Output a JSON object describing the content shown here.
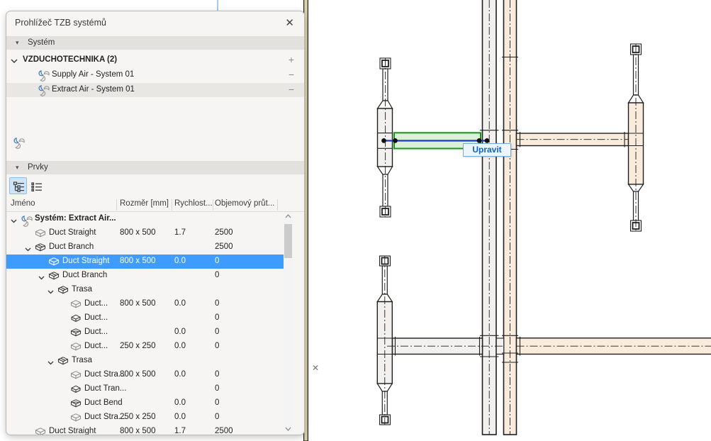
{
  "panel": {
    "title": "Prohlížeč TZB systémů",
    "close_glyph": "✕",
    "sections": {
      "system_label": "Systém",
      "elements_label": "Prvky"
    },
    "system_group": {
      "name": "VZDUCHOTECHNIKA (2)",
      "add_glyph": "+",
      "remove_glyph": "−",
      "items": [
        {
          "label": "Supply Air - System 01",
          "selected": false
        },
        {
          "label": "Extract Air - System 01",
          "selected": true
        }
      ]
    },
    "view_toggles": [
      {
        "icon": "tree-view-icon",
        "active": true
      },
      {
        "icon": "list-view-icon",
        "active": false
      }
    ],
    "table": {
      "columns": [
        "Jméno",
        "Rozměr [mm]",
        "Rychlost...",
        "Objemový průt..."
      ],
      "rows": [
        {
          "level": 0,
          "chevron": true,
          "icon": "fan-icon",
          "label": "Systém: Extract Air...",
          "bold": true,
          "size": "",
          "velocity": "",
          "flow": ""
        },
        {
          "level": 1,
          "chevron": false,
          "icon": "duct-straight-icon",
          "label": "Duct Straight",
          "bold": false,
          "size": "800 x 500",
          "velocity": "1.7",
          "flow": "2500"
        },
        {
          "level": 1,
          "chevron": true,
          "icon": "duct-branch-icon",
          "label": "Duct Branch",
          "bold": false,
          "size": "",
          "velocity": "",
          "flow": "2500"
        },
        {
          "level": 2,
          "chevron": false,
          "icon": "duct-straight-icon",
          "label": "Duct Straight",
          "bold": false,
          "size": "800 x 500",
          "velocity": "0.0",
          "flow": "0",
          "selected": true
        },
        {
          "level": 2,
          "chevron": true,
          "icon": "duct-branch-icon",
          "label": "Duct Branch",
          "bold": false,
          "size": "",
          "velocity": "",
          "flow": "0"
        },
        {
          "level": 3,
          "chevron": true,
          "icon": "duct-branch-icon",
          "label": "Trasa",
          "bold": false,
          "size": "",
          "velocity": "",
          "flow": ""
        },
        {
          "level": 4,
          "chevron": false,
          "icon": "duct-straight-icon",
          "label": "Duct...",
          "bold": false,
          "size": "800 x 500",
          "velocity": "0.0",
          "flow": "0"
        },
        {
          "level": 4,
          "chevron": false,
          "icon": "duct-transition-icon",
          "label": "Duct...",
          "bold": false,
          "size": "",
          "velocity": "",
          "flow": "0"
        },
        {
          "level": 4,
          "chevron": false,
          "icon": "duct-bend-icon",
          "label": "Duct...",
          "bold": false,
          "size": "",
          "velocity": "0.0",
          "flow": "0"
        },
        {
          "level": 4,
          "chevron": false,
          "icon": "duct-straight-icon",
          "label": "Duct...",
          "bold": false,
          "size": "250 x 250",
          "velocity": "0.0",
          "flow": "0"
        },
        {
          "level": 3,
          "chevron": true,
          "icon": "duct-branch-icon",
          "label": "Trasa",
          "bold": false,
          "size": "",
          "velocity": "",
          "flow": ""
        },
        {
          "level": 4,
          "chevron": false,
          "icon": "duct-straight-icon",
          "label": "Duct Stra...",
          "bold": false,
          "size": "800 x 500",
          "velocity": "0.0",
          "flow": "0"
        },
        {
          "level": 4,
          "chevron": false,
          "icon": "duct-transition-icon",
          "label": "Duct Tran...",
          "bold": false,
          "size": "",
          "velocity": "",
          "flow": "0"
        },
        {
          "level": 4,
          "chevron": false,
          "icon": "duct-bend-icon",
          "label": "Duct Bend",
          "bold": false,
          "size": "",
          "velocity": "0.0",
          "flow": "0"
        },
        {
          "level": 4,
          "chevron": false,
          "icon": "duct-straight-icon",
          "label": "Duct Stra...",
          "bold": false,
          "size": "250 x 250",
          "velocity": "0.0",
          "flow": "0"
        },
        {
          "level": 1,
          "chevron": false,
          "icon": "duct-straight-icon",
          "label": "Duct Straight",
          "bold": false,
          "size": "800 x 500",
          "velocity": "1.7",
          "flow": "2500"
        }
      ]
    }
  },
  "drawing": {
    "edit_tooltip": "Upravit",
    "close_marker": "✕",
    "colors": {
      "selection_row_blue": "#3f9bfd",
      "selected_duct_green": "#169616",
      "selected_duct_fill": "#dcefdb",
      "duct_centerline_blue": "#1d41c9",
      "duct_fill_white": "#f2f1ef",
      "duct_fill_tan": "#f9ecdc",
      "wall_fill": "#d9d3ac",
      "guide_line_blue": "#a6cbee"
    }
  }
}
